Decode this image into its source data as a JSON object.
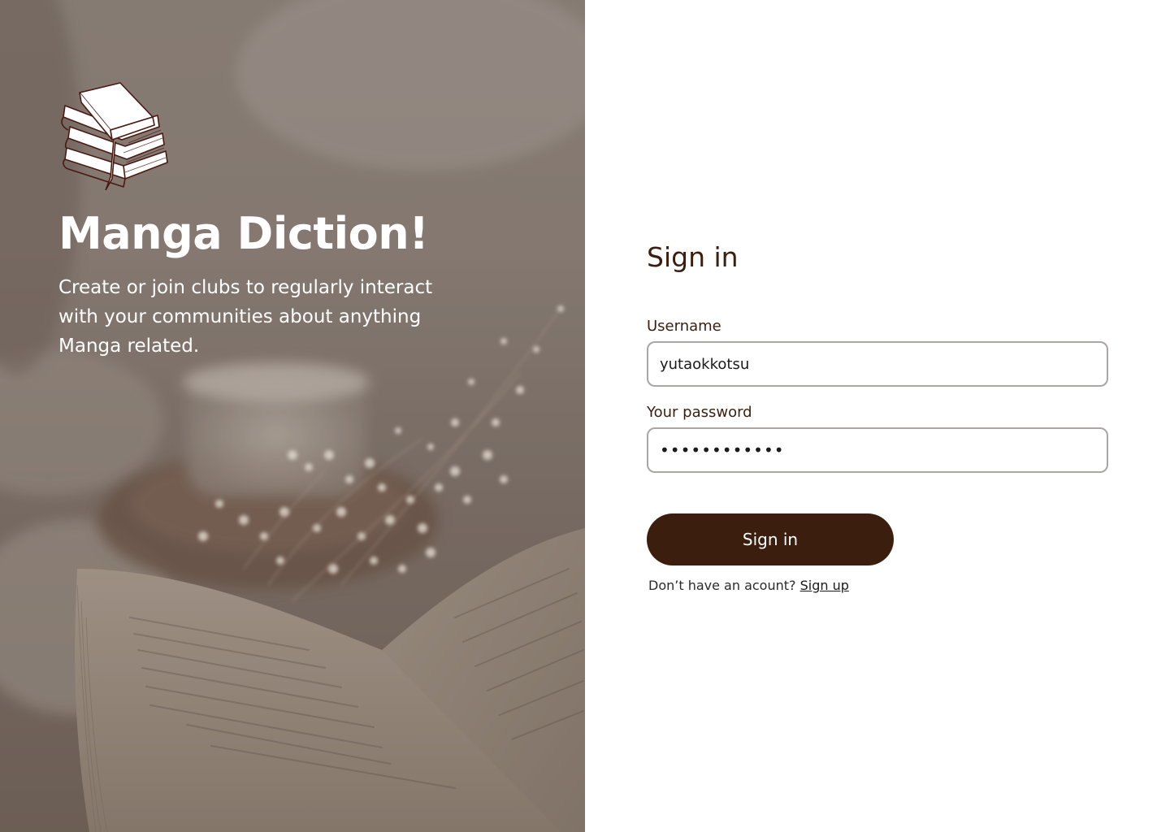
{
  "hero": {
    "logo_icon": "stacked-books-icon",
    "title": "Manga Diction!",
    "subtitle": "Create or join clubs to regularly interact with your communities about anything Manga related."
  },
  "form": {
    "title": "Sign in",
    "username_label": "Username",
    "username_value": "yutaokkotsu",
    "password_label": "Your password",
    "password_value": "••••••••••••",
    "submit_label": "Sign in",
    "signup_prompt": "Don’t have an acount?",
    "signup_link": "Sign up"
  },
  "colors": {
    "brand_dark_brown": "#3b1e0e",
    "input_border": "#a9a6a4",
    "hero_overlay": "#8a7f78"
  }
}
